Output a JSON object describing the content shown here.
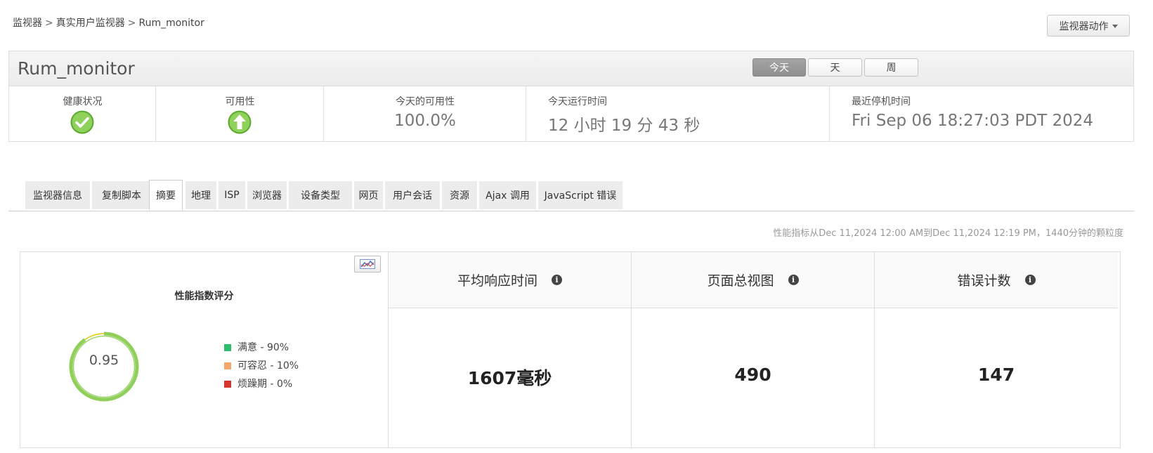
{
  "breadcrumb": {
    "items": [
      "监视器",
      "真实用户监视器"
    ],
    "current": "Rum_monitor",
    "separator": ">"
  },
  "actions": {
    "label": "监视器动作"
  },
  "header": {
    "title": "Rum_monitor",
    "periods": [
      {
        "label": "今天",
        "active": true
      },
      {
        "label": "天",
        "active": false
      },
      {
        "label": "周",
        "active": false
      }
    ],
    "stats": {
      "health_label": "健康状况",
      "availability_label": "可用性",
      "today_availability_label": "今天的可用性",
      "today_availability_value": "100.0%",
      "uptime_label": "今天运行时间",
      "uptime_value": "12 小时 19 分 43 秒",
      "last_down_label": "最近停机时间",
      "last_down_value": "Fri Sep 06 18:27:03 PDT 2024"
    },
    "health_icon": "check-circle-icon",
    "availability_icon": "up-arrow-circle-icon",
    "status_color": "#7dc242"
  },
  "tabs": [
    {
      "label": "监视器信息",
      "active": false
    },
    {
      "label": "复制脚本",
      "active": false
    },
    {
      "label": "摘要",
      "active": true
    },
    {
      "label": "地理",
      "active": false
    },
    {
      "label": "ISP",
      "active": false
    },
    {
      "label": "浏览器",
      "active": false
    },
    {
      "label": "设备类型",
      "active": false
    },
    {
      "label": "网页",
      "active": false
    },
    {
      "label": "用户会话",
      "active": false
    },
    {
      "label": "资源",
      "active": false
    },
    {
      "label": "Ajax 调用",
      "active": false
    },
    {
      "label": "JavaScript 错误",
      "active": false
    }
  ],
  "range_note": "性能指标从Dec 11,2024 12:00 AM到Dec 11,2024 12:19 PM，1440分钟的颗粒度",
  "apdex": {
    "title": "性能指数评分",
    "score": "0.95",
    "toggle_icon": "chart-toggle-icon",
    "segments": [
      {
        "label": "满意 - 90%",
        "fraction": 0.9,
        "color": "#2dbe6c",
        "ring_color": "#8fcf5a"
      },
      {
        "label": "可容忍 - 10%",
        "fraction": 0.1,
        "color": "#f5a76b",
        "ring_color": "#e9d23a"
      },
      {
        "label": "烦躁期 - 0%",
        "fraction": 0.0,
        "color": "#d9342b",
        "ring_color": "#d9342b"
      }
    ]
  },
  "metrics": [
    {
      "label": "平均响应时间",
      "value": "1607毫秒"
    },
    {
      "label": "页面总视图",
      "value": "490"
    },
    {
      "label": "错误计数",
      "value": "147"
    }
  ]
}
